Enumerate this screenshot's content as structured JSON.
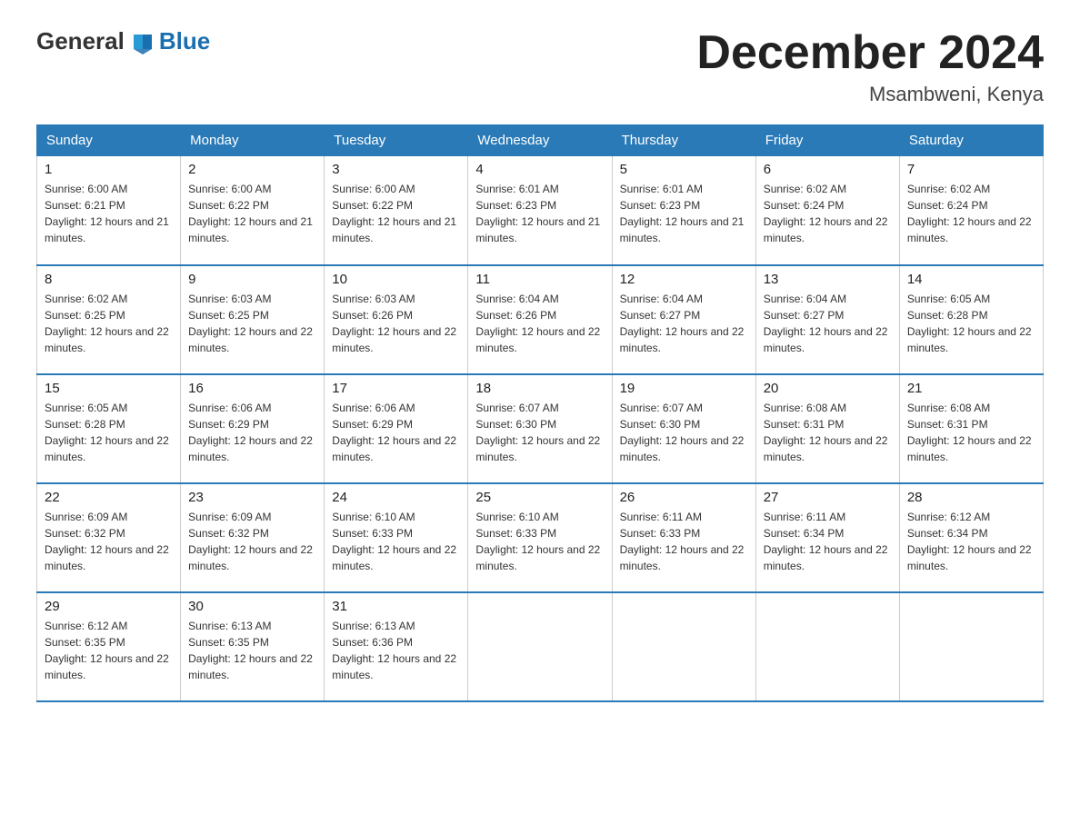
{
  "logo": {
    "general": "General",
    "blue": "Blue"
  },
  "header": {
    "month": "December 2024",
    "location": "Msambweni, Kenya"
  },
  "weekdays": [
    "Sunday",
    "Monday",
    "Tuesday",
    "Wednesday",
    "Thursday",
    "Friday",
    "Saturday"
  ],
  "weeks": [
    [
      {
        "day": "1",
        "sunrise": "6:00 AM",
        "sunset": "6:21 PM",
        "daylight": "12 hours and 21 minutes."
      },
      {
        "day": "2",
        "sunrise": "6:00 AM",
        "sunset": "6:22 PM",
        "daylight": "12 hours and 21 minutes."
      },
      {
        "day": "3",
        "sunrise": "6:00 AM",
        "sunset": "6:22 PM",
        "daylight": "12 hours and 21 minutes."
      },
      {
        "day": "4",
        "sunrise": "6:01 AM",
        "sunset": "6:23 PM",
        "daylight": "12 hours and 21 minutes."
      },
      {
        "day": "5",
        "sunrise": "6:01 AM",
        "sunset": "6:23 PM",
        "daylight": "12 hours and 21 minutes."
      },
      {
        "day": "6",
        "sunrise": "6:02 AM",
        "sunset": "6:24 PM",
        "daylight": "12 hours and 22 minutes."
      },
      {
        "day": "7",
        "sunrise": "6:02 AM",
        "sunset": "6:24 PM",
        "daylight": "12 hours and 22 minutes."
      }
    ],
    [
      {
        "day": "8",
        "sunrise": "6:02 AM",
        "sunset": "6:25 PM",
        "daylight": "12 hours and 22 minutes."
      },
      {
        "day": "9",
        "sunrise": "6:03 AM",
        "sunset": "6:25 PM",
        "daylight": "12 hours and 22 minutes."
      },
      {
        "day": "10",
        "sunrise": "6:03 AM",
        "sunset": "6:26 PM",
        "daylight": "12 hours and 22 minutes."
      },
      {
        "day": "11",
        "sunrise": "6:04 AM",
        "sunset": "6:26 PM",
        "daylight": "12 hours and 22 minutes."
      },
      {
        "day": "12",
        "sunrise": "6:04 AM",
        "sunset": "6:27 PM",
        "daylight": "12 hours and 22 minutes."
      },
      {
        "day": "13",
        "sunrise": "6:04 AM",
        "sunset": "6:27 PM",
        "daylight": "12 hours and 22 minutes."
      },
      {
        "day": "14",
        "sunrise": "6:05 AM",
        "sunset": "6:28 PM",
        "daylight": "12 hours and 22 minutes."
      }
    ],
    [
      {
        "day": "15",
        "sunrise": "6:05 AM",
        "sunset": "6:28 PM",
        "daylight": "12 hours and 22 minutes."
      },
      {
        "day": "16",
        "sunrise": "6:06 AM",
        "sunset": "6:29 PM",
        "daylight": "12 hours and 22 minutes."
      },
      {
        "day": "17",
        "sunrise": "6:06 AM",
        "sunset": "6:29 PM",
        "daylight": "12 hours and 22 minutes."
      },
      {
        "day": "18",
        "sunrise": "6:07 AM",
        "sunset": "6:30 PM",
        "daylight": "12 hours and 22 minutes."
      },
      {
        "day": "19",
        "sunrise": "6:07 AM",
        "sunset": "6:30 PM",
        "daylight": "12 hours and 22 minutes."
      },
      {
        "day": "20",
        "sunrise": "6:08 AM",
        "sunset": "6:31 PM",
        "daylight": "12 hours and 22 minutes."
      },
      {
        "day": "21",
        "sunrise": "6:08 AM",
        "sunset": "6:31 PM",
        "daylight": "12 hours and 22 minutes."
      }
    ],
    [
      {
        "day": "22",
        "sunrise": "6:09 AM",
        "sunset": "6:32 PM",
        "daylight": "12 hours and 22 minutes."
      },
      {
        "day": "23",
        "sunrise": "6:09 AM",
        "sunset": "6:32 PM",
        "daylight": "12 hours and 22 minutes."
      },
      {
        "day": "24",
        "sunrise": "6:10 AM",
        "sunset": "6:33 PM",
        "daylight": "12 hours and 22 minutes."
      },
      {
        "day": "25",
        "sunrise": "6:10 AM",
        "sunset": "6:33 PM",
        "daylight": "12 hours and 22 minutes."
      },
      {
        "day": "26",
        "sunrise": "6:11 AM",
        "sunset": "6:33 PM",
        "daylight": "12 hours and 22 minutes."
      },
      {
        "day": "27",
        "sunrise": "6:11 AM",
        "sunset": "6:34 PM",
        "daylight": "12 hours and 22 minutes."
      },
      {
        "day": "28",
        "sunrise": "6:12 AM",
        "sunset": "6:34 PM",
        "daylight": "12 hours and 22 minutes."
      }
    ],
    [
      {
        "day": "29",
        "sunrise": "6:12 AM",
        "sunset": "6:35 PM",
        "daylight": "12 hours and 22 minutes."
      },
      {
        "day": "30",
        "sunrise": "6:13 AM",
        "sunset": "6:35 PM",
        "daylight": "12 hours and 22 minutes."
      },
      {
        "day": "31",
        "sunrise": "6:13 AM",
        "sunset": "6:36 PM",
        "daylight": "12 hours and 22 minutes."
      },
      null,
      null,
      null,
      null
    ]
  ]
}
